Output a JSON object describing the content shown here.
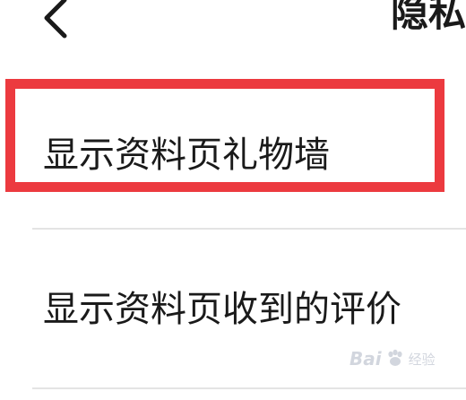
{
  "header": {
    "title": "隐私",
    "back_icon": "chevron-left-icon"
  },
  "settings": {
    "items": [
      {
        "label": "显示资料页礼物墙",
        "highlighted": true
      },
      {
        "label": "显示资料页收到的评价",
        "highlighted": false
      }
    ]
  },
  "highlight": {
    "color": "#ec3a3f"
  },
  "watermark": {
    "brand": "Bai",
    "sub": "经验"
  }
}
